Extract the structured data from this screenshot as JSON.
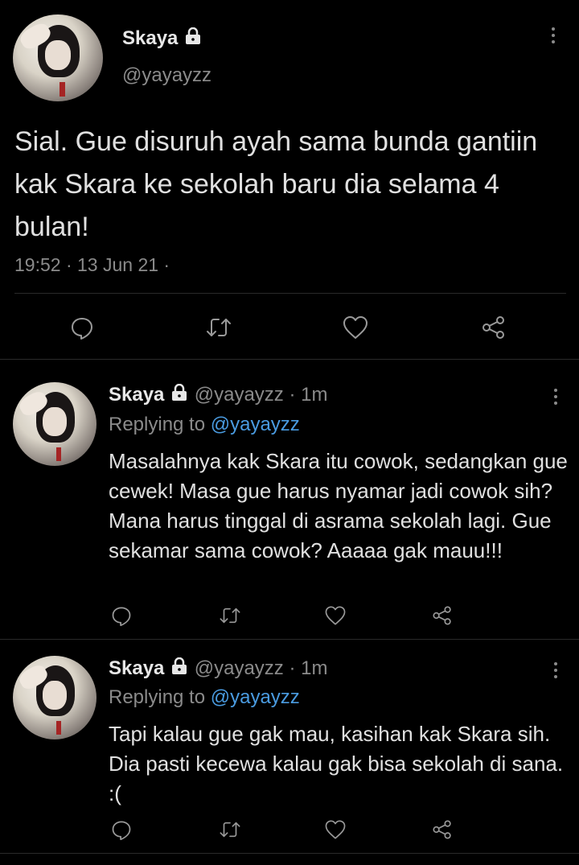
{
  "main": {
    "name": "Skaya",
    "handle": "@yayayzz",
    "text": "Sial. Gue disuruh ayah sama bunda gantiin kak Skara ke sekolah baru dia selama 4 bulan!",
    "timestamp": "19:52 · 13 Jun 21 ·"
  },
  "replies": [
    {
      "name": "Skaya",
      "handle": "@yayayzz",
      "time": "· 1m",
      "replying_prefix": "Replying to",
      "replying_to": "@yayayzz",
      "text": "Masalahnya kak Skara itu cowok, sedangkan gue cewek! Masa gue harus nyamar jadi cowok sih? Mana harus tinggal di asrama sekolah lagi. Gue sekamar sama cowok? Aaaaa gak mauu!!!"
    },
    {
      "name": "Skaya",
      "handle": "@yayayzz",
      "time": "· 1m",
      "replying_prefix": "Replying to",
      "replying_to": "@yayayzz",
      "text": "Tapi kalau gue gak mau, kasihan kak Skara sih. Dia pasti kecewa kalau gak bisa sekolah di sana. :("
    }
  ],
  "icons": {
    "reply": "reply-icon",
    "retweet": "retweet-icon",
    "like": "heart-icon",
    "share": "share-icon",
    "lock": "lock-icon",
    "more": "more-vertical-icon"
  },
  "colors": {
    "background": "#000000",
    "text": "#e0e0e0",
    "secondary": "#8b8b8b",
    "link": "#4a9be0",
    "divider": "#2a2a2a"
  }
}
